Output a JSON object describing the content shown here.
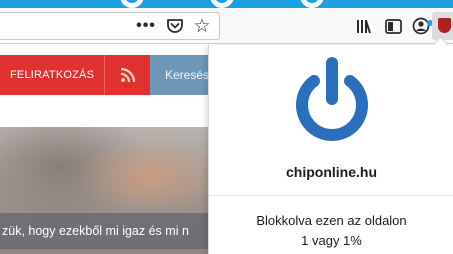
{
  "browser": {
    "toolbar": {
      "page_actions_icon": "more-dots-icon",
      "page_actions_glyph": "•••",
      "pocket_icon": "pocket-icon",
      "bookmark_icon": "star-icon",
      "bookmark_glyph": "☆",
      "library_icon": "library-icon",
      "sidebar_icon": "sidebar-icon",
      "account_icon": "account-icon",
      "extension_icon": "ublock-shield-icon"
    }
  },
  "webpage": {
    "nav": {
      "subscribe_label": "FELIRATKOZÁS",
      "rss_icon": "rss-icon",
      "search_label": "Keresés"
    },
    "hero": {
      "caption": "zük, hogy ezekből mi igaz és mi n"
    },
    "colors": {
      "nav_red": "#e03131",
      "search_blue": "#6f98b8",
      "header_cyan": "#1a9fe0"
    }
  },
  "popup": {
    "power_icon": "power-icon",
    "power_color": "#2a6fbd",
    "domain": "chiponline.hu",
    "blocked_label": "Blokkolva ezen az oldalon",
    "blocked_value": "1 vagy 1%"
  }
}
